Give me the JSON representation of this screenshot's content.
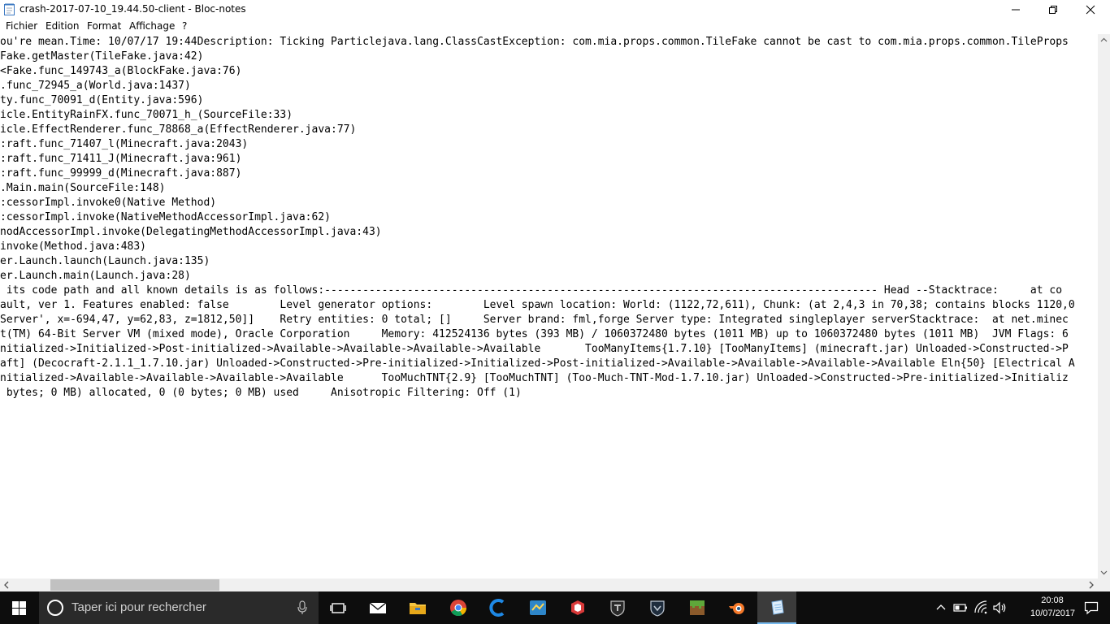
{
  "window": {
    "title": "crash-2017-07-10_19.44.50-client - Bloc-notes",
    "icons": {
      "app": "notepad-icon",
      "minimize": "minimize-icon",
      "maximize": "maximize-icon",
      "close": "close-icon"
    }
  },
  "menu": {
    "file": "Fichier",
    "edit": "Edition",
    "format": "Format",
    "view": "Affichage",
    "help": "?"
  },
  "editor": {
    "lines": [
      "ou're mean.Time: 10/07/17 19:44Description: Ticking Particlejava.lang.ClassCastException: com.mia.props.common.TileFake cannot be cast to com.mia.props.common.TileProps",
      "Fake.getMaster(TileFake.java:42)",
      "<Fake.func_149743_a(BlockFake.java:76)",
      ".func_72945_a(World.java:1437)",
      "ty.func_70091_d(Entity.java:596)",
      "icle.EntityRainFX.func_70071_h_(SourceFile:33)",
      "icle.EffectRenderer.func_78868_a(EffectRenderer.java:77)",
      ":raft.func_71407_l(Minecraft.java:2043)",
      ":raft.func_71411_J(Minecraft.java:961)",
      ":raft.func_99999_d(Minecraft.java:887)",
      ".Main.main(SourceFile:148)",
      ":cessorImpl.invoke0(Native Method)",
      ":cessorImpl.invoke(NativeMethodAccessorImpl.java:62)",
      "nodAccessorImpl.invoke(DelegatingMethodAccessorImpl.java:43)",
      "invoke(Method.java:483)",
      "er.Launch.launch(Launch.java:135)",
      "er.Launch.main(Launch.java:28)",
      " its code path and all known details is as follows:--------------------------------------------------------------------------------------- Head --Stacktrace:     at co",
      "ault, ver 1. Features enabled: false        Level generator options:        Level spawn location: World: (1122,72,611), Chunk: (at 2,4,3 in 70,38; contains blocks 1120,0",
      "Server', x=-694,47, y=62,83, z=1812,50]]    Retry entities: 0 total; []     Server brand: fml,forge Server type: Integrated singleplayer serverStacktrace:  at net.minec",
      "t(TM) 64-Bit Server VM (mixed mode), Oracle Corporation     Memory: 412524136 bytes (393 MB) / 1060372480 bytes (1011 MB) up to 1060372480 bytes (1011 MB)  JVM Flags: 6",
      "nitialized->Initialized->Post-initialized->Available->Available->Available->Available       TooManyItems{1.7.10} [TooManyItems] (minecraft.jar) Unloaded->Constructed->P",
      "aft] (Decocraft-2.1.1_1.7.10.jar) Unloaded->Constructed->Pre-initialized->Initialized->Post-initialized->Available->Available->Available->Available Eln{50} [Electrical A",
      "nitialized->Available->Available->Available->Available      TooMuchTNT{2.9} [TooMuchTNT] (Too-Much-TNT-Mod-1.7.10.jar) Unloaded->Constructed->Pre-initialized->Initializ",
      " bytes; 0 MB) allocated, 0 (0 bytes; 0 MB) used     Anisotropic Filtering: Off (1)"
    ]
  },
  "scrollbars": {
    "icons": {
      "up": "scroll-up-arrow-icon",
      "down": "scroll-down-arrow-icon",
      "left": "scroll-left-arrow-icon",
      "right": "scroll-right-arrow-icon"
    }
  },
  "taskbar": {
    "search_placeholder": "Taper ici pour rechercher",
    "pinned": [
      {
        "name": "task-view-icon"
      },
      {
        "name": "mail-icon"
      },
      {
        "name": "file-explorer-icon"
      },
      {
        "name": "chrome-icon"
      },
      {
        "name": "ccleaner-icon"
      },
      {
        "name": "app-blue-icon"
      },
      {
        "name": "sketchup-icon"
      },
      {
        "name": "world-of-tanks-icon"
      },
      {
        "name": "world-of-warships-icon"
      },
      {
        "name": "minecraft-icon"
      },
      {
        "name": "blender-icon"
      },
      {
        "name": "notepad-icon"
      }
    ],
    "clock": {
      "time": "20:08",
      "date": "10/07/2017"
    },
    "colors": {
      "background": "#0d0d0d",
      "search_bg": "#2a2a2a",
      "active_underline": "#76b9ed"
    }
  }
}
